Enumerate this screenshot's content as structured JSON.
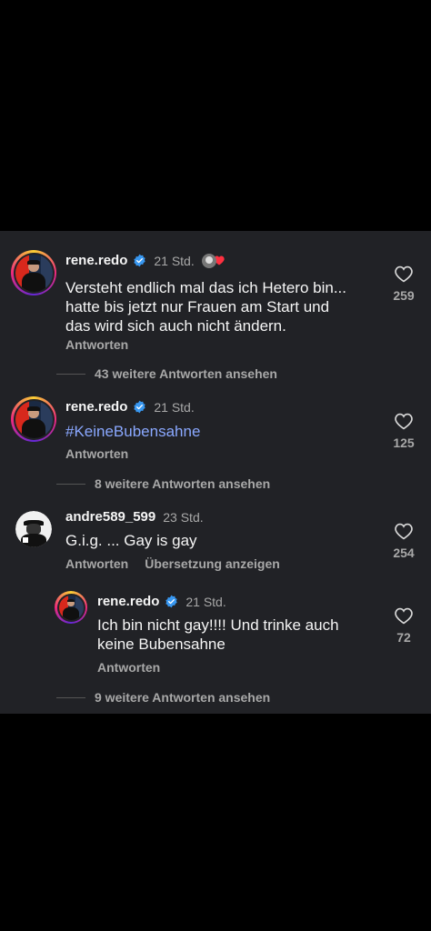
{
  "comments": [
    {
      "username": "rene.redo",
      "time": "21 Std.",
      "text_lines": [
        "Versteht endlich mal das ich Hetero bin...",
        "hatte bis jetzt nur Frauen am Start und",
        "das wird sich auch nicht ändern."
      ],
      "reply_label": "Antworten",
      "like_count": "259",
      "more_replies": "43 weitere Antworten ansehen"
    },
    {
      "username": "rene.redo",
      "time": "21 Std.",
      "hashtag": "#KeineBubensahne",
      "reply_label": "Antworten",
      "like_count": "125",
      "more_replies": "8 weitere Antworten ansehen"
    },
    {
      "username": "andre589_599",
      "time": "23 Std.",
      "text": "G.i.g. ... Gay is gay",
      "reply_label": "Antworten",
      "translate_label": "Übersetzung anzeigen",
      "like_count": "254"
    },
    {
      "username": "rene.redo",
      "time": "21 Std.",
      "text_lines": [
        "Ich bin nicht gay!!!! Und trinke auch",
        "keine Bubensahne"
      ],
      "reply_label": "Antworten",
      "like_count": "72",
      "more_replies": "9 weitere Antworten ansehen"
    }
  ],
  "colors": {
    "panel": "#212226",
    "verified": "#3897f0",
    "hashtag": "#8aa8ff",
    "secondary_text": "#a8a8a8",
    "reaction_heart": "#ff3040"
  },
  "icons": {
    "verified": "verified-badge-icon",
    "like": "heart-outline-icon",
    "reaction": "creator-liked-heart-icon"
  }
}
